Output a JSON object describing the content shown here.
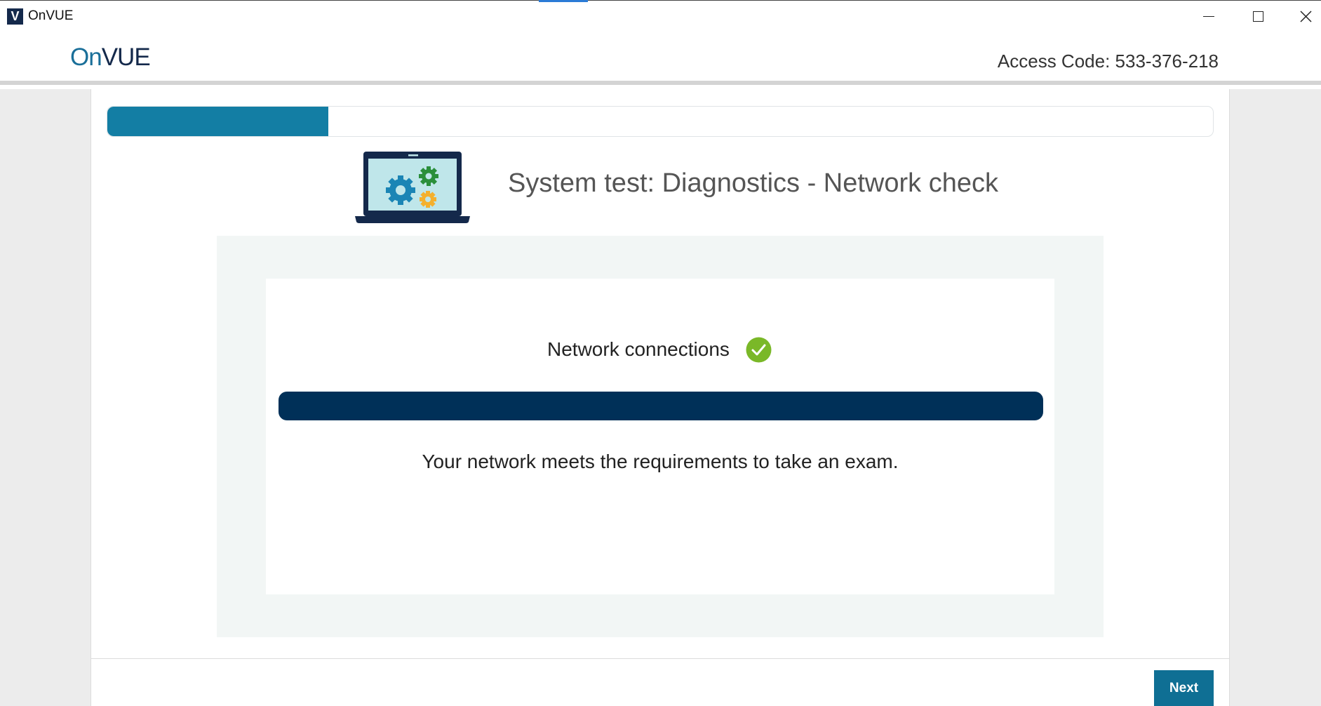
{
  "window": {
    "title": "OnVUE",
    "icon": "V"
  },
  "header": {
    "logo": {
      "part1": "On",
      "part2": "VUE"
    },
    "access_code": "Access Code: 533-376-218"
  },
  "progress": {
    "fraction": 0.2
  },
  "page": {
    "title": "System test: Diagnostics - Network check"
  },
  "check": {
    "label": "Network connections",
    "status": "passed",
    "progress_fraction": 1.0,
    "message": "Your network meets the requirements to take an exam."
  },
  "footer": {
    "next_label": "Next"
  },
  "colors": {
    "brand_teal": "#137ea4",
    "navy": "#003058",
    "success_green": "#7ab828",
    "button": "#0f6f94"
  },
  "icons": [
    "app-icon",
    "minimize-icon",
    "maximize-icon",
    "close-icon",
    "laptop-gears-icon",
    "checkmark-icon"
  ]
}
